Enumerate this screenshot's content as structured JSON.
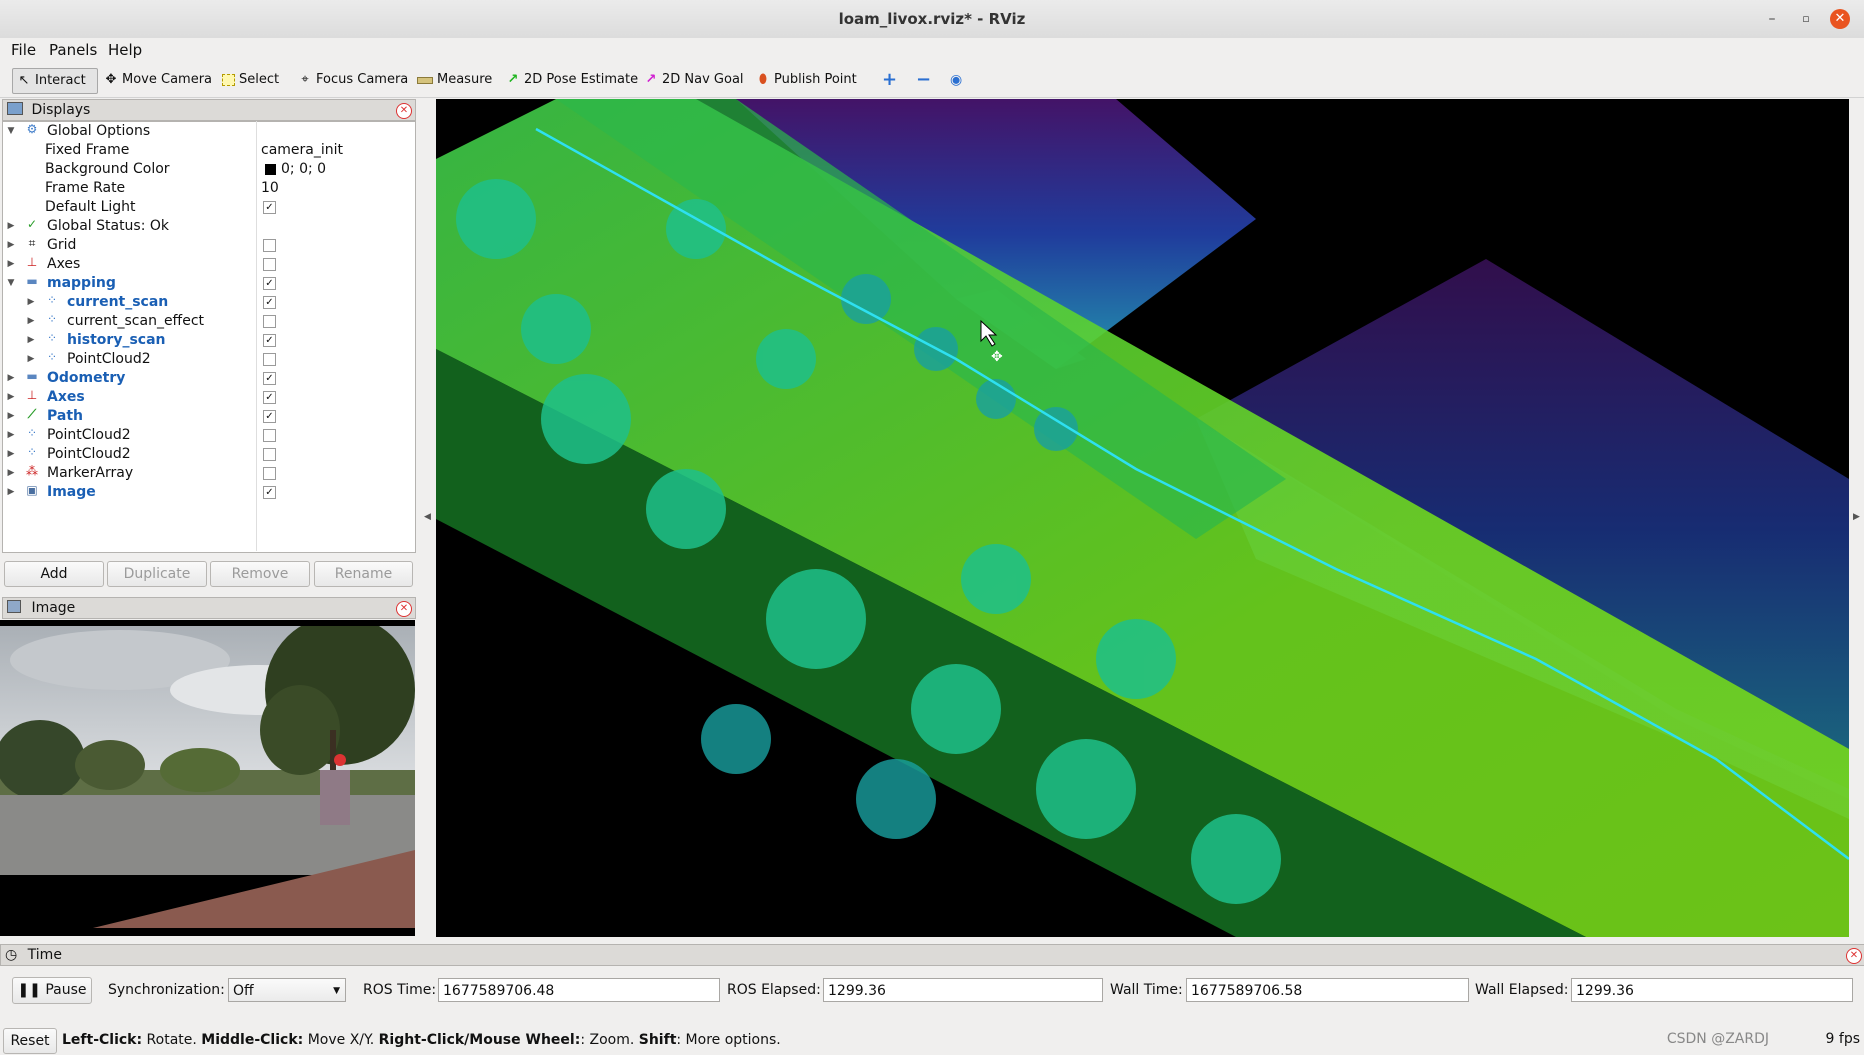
{
  "window": {
    "title": "loam_livox.rviz* - RViz"
  },
  "menu": [
    "File",
    "Panels",
    "Help"
  ],
  "toolbar": [
    {
      "label": "Interact",
      "icon": "cursor-icon"
    },
    {
      "label": "Move Camera",
      "icon": "move-camera-icon"
    },
    {
      "label": "Select",
      "icon": "select-icon"
    },
    {
      "label": "Focus Camera",
      "icon": "focus-camera-icon"
    },
    {
      "label": "Measure",
      "icon": "ruler-icon"
    },
    {
      "label": "2D Pose Estimate",
      "icon": "pose-arrow-icon"
    },
    {
      "label": "2D Nav Goal",
      "icon": "nav-goal-arrow-icon"
    },
    {
      "label": "Publish Point",
      "icon": "pin-icon"
    }
  ],
  "displays": {
    "title": "Displays",
    "global_options": "Global Options",
    "fixed_frame": {
      "label": "Fixed Frame",
      "value": "camera_init"
    },
    "background_color": {
      "label": "Background Color",
      "value": "0; 0; 0"
    },
    "frame_rate": {
      "label": "Frame Rate",
      "value": "10"
    },
    "default_light": {
      "label": "Default Light"
    },
    "global_status": "Global Status: Ok",
    "items": [
      {
        "label": "Grid",
        "checked": false
      },
      {
        "label": "Axes",
        "checked": false
      },
      {
        "label": "mapping",
        "checked": true
      },
      {
        "label": "current_scan",
        "checked": true
      },
      {
        "label": "current_scan_effect",
        "checked": false
      },
      {
        "label": "history_scan",
        "checked": true
      },
      {
        "label": "PointCloud2",
        "checked": false
      },
      {
        "label": "Odometry",
        "checked": true
      },
      {
        "label": "Axes",
        "checked": true
      },
      {
        "label": "Path",
        "checked": true
      },
      {
        "label": "PointCloud2",
        "checked": false
      },
      {
        "label": "PointCloud2",
        "checked": false
      },
      {
        "label": "MarkerArray",
        "checked": false
      },
      {
        "label": "Image",
        "checked": true
      }
    ],
    "buttons": {
      "add": "Add",
      "duplicate": "Duplicate",
      "remove": "Remove",
      "rename": "Rename"
    }
  },
  "image_panel": {
    "title": "Image"
  },
  "time": {
    "title": "Time",
    "pause": "Pause",
    "sync_label": "Synchronization:",
    "sync_value": "Off",
    "ros_time_label": "ROS Time:",
    "ros_time": "1677589706.48",
    "ros_elapsed_label": "ROS Elapsed:",
    "ros_elapsed": "1299.36",
    "wall_time_label": "Wall Time:",
    "wall_time": "1677589706.58",
    "wall_elapsed_label": "Wall Elapsed:",
    "wall_elapsed": "1299.36"
  },
  "status": {
    "reset": "Reset",
    "left_click": "Left-Click:",
    "left_click_desc": " Rotate. ",
    "middle_click": "Middle-Click:",
    "middle_click_desc": " Move X/Y. ",
    "right_click": "Right-Click/Mouse Wheel:",
    "right_click_desc": ": Zoom. ",
    "shift": "Shift",
    "shift_desc": ": More options.",
    "fps": "9 fps",
    "watermark": "CSDN @ZARDJ"
  }
}
